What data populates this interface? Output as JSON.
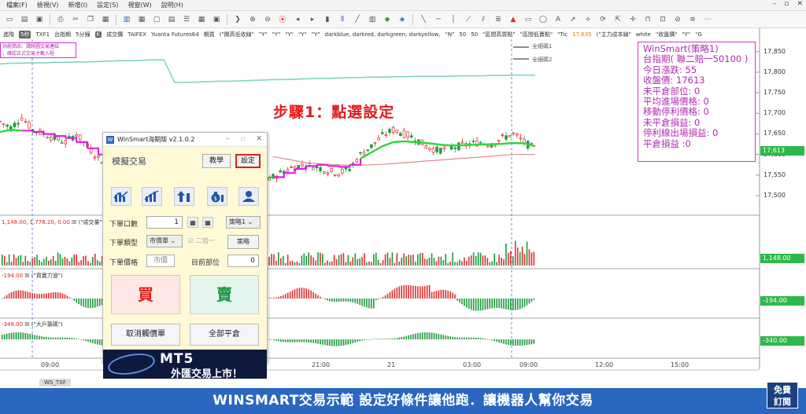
{
  "menu": {
    "items": [
      "檔案(F)",
      "檢視(V)",
      "新增(I)",
      "設定(S)",
      "視窗(W)",
      "說明(H)"
    ]
  },
  "infobar": {
    "segments": [
      "進階",
      "5秒",
      "TXF1",
      "台指期",
      "5分鐘",
      "K",
      "成交價",
      "TAIFEX",
      "Yuanta Futures64",
      "期貨",
      "(\"開高低收線\"",
      "\"Y\"",
      "\"Y\"",
      "\"Y\"",
      "\"Y\"",
      "\"Y\"",
      "darkblue, darkred, darkgreen, darkyellow,",
      "\"N\"",
      "50",
      "50",
      "\"區間高買點\"",
      "\"區間低賣點\"",
      "\"Tic",
      "17,635",
      "(\"主力成本線\"",
      "white",
      "\"收盤價\"",
      "\"Y\"",
      "\"G"
    ]
  },
  "notice": {
    "line1": "功能簡品：請將圖交易連結",
    "line2": "，確認正式交易才載入程"
  },
  "step_title": "步驟1：點選設定",
  "hedge": {
    "label1": "全細碼1",
    "label2": "全細碼2"
  },
  "winsmart_box": {
    "lines": [
      "WinSmart(策略1)",
      "台指期( 聯二賠一50100 )",
      "今日漲跌: 55",
      "收盤價: 17613",
      "未平倉部位: 0",
      "平均進場價格: 0",
      "移動停利價格: 0",
      "未平倉損益: 0",
      "停利線出場損益: 0",
      "平倉損益 :0"
    ]
  },
  "price_axis": {
    "ticks": [
      "17,850",
      "17,800",
      "17,750",
      "17,700",
      "17,650",
      "17,600",
      "17,550",
      "17,500"
    ],
    "current_tag": "17,613"
  },
  "volume": {
    "label": "1,148.00",
    "label2": "1,776.20",
    "label3": "0.00",
    "title": "(\"成交量\"",
    "tag": "1,148.00"
  },
  "indicator1": {
    "value": "-194.00",
    "title": "(\"買賣力道\")",
    "tag": "-194.00"
  },
  "indicator2": {
    "value": "-349.00",
    "title": "(\"大戶籌碼\")",
    "tag": "-340.00"
  },
  "time_axis": [
    "09:00",
    "21:00",
    "21",
    "03:00",
    "09:00",
    "12:00",
    "15:00"
  ],
  "sheet_tab": "WS_TXF",
  "dialog": {
    "title": "WinSmart海期版 v2.1.0.2",
    "sim_label": "模擬交易",
    "teach_button": "教學",
    "settings_button": "設定",
    "qty_label": "下單口數",
    "qty_value": "1",
    "strategy_select": "策略1",
    "order_type_label": "下單類型",
    "order_type_value": "市價單",
    "double_checkbox": "二倍一",
    "strategy_button": "策略",
    "order_price_label": "下單價格",
    "order_price_value": "市價",
    "position_label": "目前部位",
    "position_value": "0",
    "buy_button": "買",
    "sell_button": "賣",
    "cancel_button": "取消觸價單",
    "flatten_button": "全部平倉",
    "banner_title": "MT5",
    "banner_sub": "外匯交易上市！"
  },
  "caption": "WINSMART交易示範   設定好條件讓他跑．讓機器人幫你交易",
  "free_badge": {
    "line1": "免費",
    "line2": "訂閱"
  },
  "chart_data": {
    "type": "candlestick",
    "y_axis_ticks": [
      17850,
      17800,
      17750,
      17700,
      17650,
      17600,
      17550,
      17500
    ],
    "ylim": [
      17460,
      17880
    ],
    "close": 17613,
    "price_path": [
      17680,
      17665,
      17690,
      17660,
      17650,
      17640,
      17630,
      17650,
      17620,
      17590,
      17580,
      17570,
      17560,
      17555,
      17560,
      17565,
      17575,
      17570,
      17560,
      17550,
      17545,
      17540,
      17530,
      17520,
      17525,
      17545,
      17560,
      17570,
      17575,
      17570,
      17560,
      17555,
      17565,
      17600,
      17620,
      17645,
      17660,
      17650,
      17640,
      17620,
      17610,
      17615,
      17620,
      17625,
      17630,
      17625,
      17640,
      17650,
      17630,
      17613
    ],
    "ma_green": [
      17655,
      17660,
      17658,
      17655,
      17650,
      17645,
      17640,
      17630,
      17615,
      17600,
      17588,
      17578,
      17570,
      17565,
      17562,
      17560,
      17560,
      17558,
      17556,
      17553,
      17550,
      17548,
      17545,
      17542,
      17540,
      17545,
      17555,
      17565,
      17572,
      17575,
      17572,
      17570,
      17575,
      17590,
      17605,
      17620,
      17630,
      17632,
      17630,
      17628,
      17625,
      17622,
      17622,
      17623,
      17624,
      17625,
      17626,
      17628,
      17627,
      17620
    ],
    "ma_cyan": [
      17820,
      17822,
      17822,
      17823,
      17823,
      17824,
      17824,
      17825,
      17825,
      17826,
      17827,
      17828,
      17828,
      17829,
      17830,
      17830,
      17775,
      17775,
      17776,
      17777,
      17778,
      17778,
      17779,
      17780,
      17781,
      17782,
      17782,
      17783,
      17784,
      17785,
      17785,
      17786,
      17787,
      17787,
      17788,
      17788,
      17789,
      17789,
      17790,
      17790,
      17790,
      17790,
      17791,
      17791,
      17791,
      17792,
      17792,
      17793,
      17793,
      17793
    ],
    "ma_red": [
      null,
      null,
      null,
      null,
      null,
      null,
      null,
      null,
      null,
      null,
      null,
      null,
      null,
      null,
      null,
      null,
      null,
      null,
      null,
      null,
      null,
      null,
      null,
      null,
      null,
      17595,
      17590,
      17585,
      17580,
      17578,
      17576,
      17575,
      17574,
      17574,
      17575,
      17576,
      17578,
      17580,
      17582,
      17584,
      17586,
      17588,
      17590,
      17592,
      17594,
      17596,
      17598,
      17600,
      17600,
      17600
    ]
  }
}
